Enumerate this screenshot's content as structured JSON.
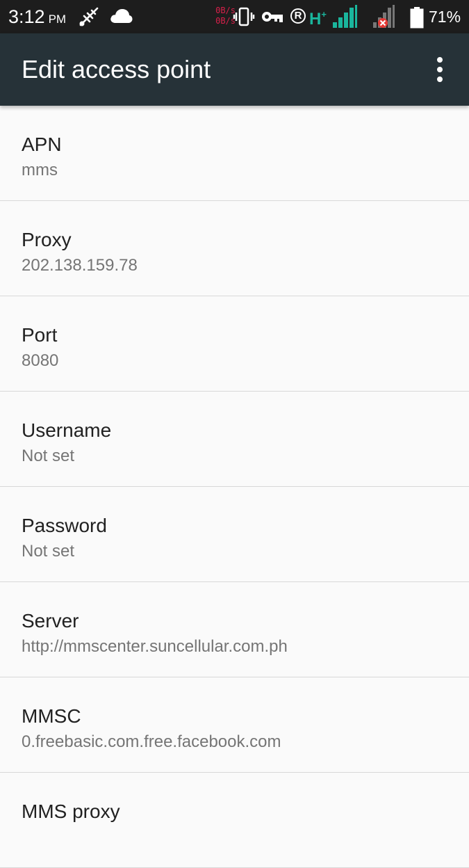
{
  "status_bar": {
    "time": "3:12",
    "ampm": "PM",
    "net_speed_up": "0B/s",
    "net_speed_down": "0B/s",
    "roaming": "R",
    "network_type": "H",
    "network_type_sup": "+",
    "battery_percent": "71%",
    "icons": [
      "usb-debug-icon",
      "cloud-icon",
      "vibrate-icon",
      "vpn-key-icon",
      "roaming-icon",
      "signal-icon",
      "signal-no-data-icon",
      "battery-icon"
    ]
  },
  "toolbar": {
    "title": "Edit access point",
    "overflow_icon": "more-vert-icon"
  },
  "items": [
    {
      "title": "APN",
      "summary": "mms"
    },
    {
      "title": "Proxy",
      "summary": "202.138.159.78"
    },
    {
      "title": "Port",
      "summary": "8080"
    },
    {
      "title": "Username",
      "summary": "Not set"
    },
    {
      "title": "Password",
      "summary": "Not set"
    },
    {
      "title": "Server",
      "summary": "http://mmscenter.suncellular.com.ph"
    },
    {
      "title": "MMSC",
      "summary": "0.freebasic.com.free.facebook.com"
    },
    {
      "title": "MMS proxy",
      "summary": ""
    }
  ],
  "colors": {
    "status_bar": "#1d1d1d",
    "toolbar": "#263238",
    "background": "#fafafa",
    "accent_teal": "#1ab69d",
    "net_speed": "#d7204a",
    "alert_red": "#e53935"
  }
}
